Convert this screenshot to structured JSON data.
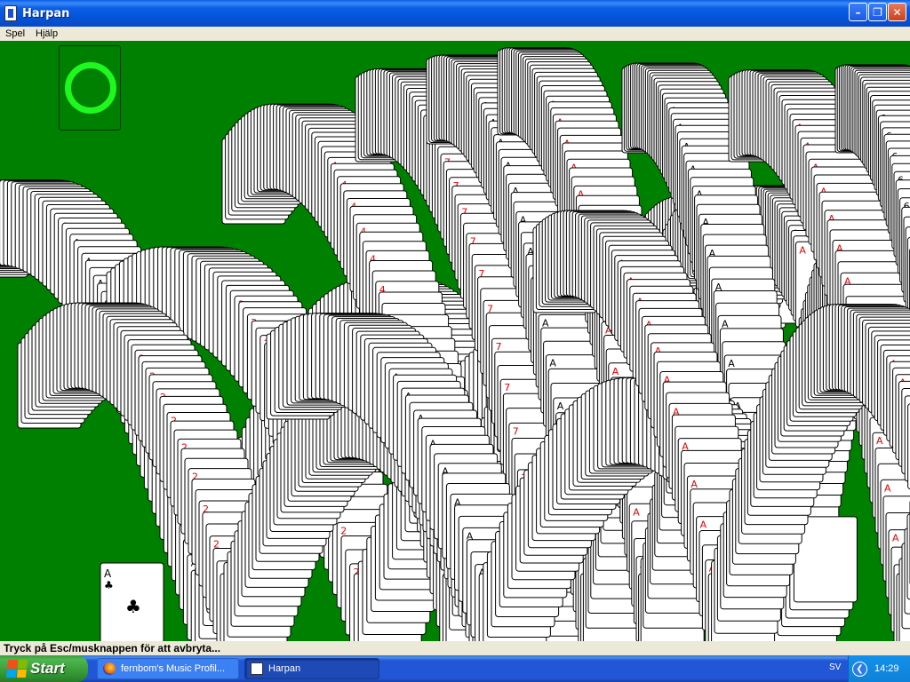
{
  "window": {
    "title": "Harpan",
    "min_symbol": "–",
    "max_symbol": "❐",
    "close_symbol": "✕"
  },
  "menu": {
    "items": [
      "Spel",
      "Hjälp"
    ]
  },
  "status": {
    "text": "Tryck på Esc/musknappen för att avbryta..."
  },
  "taskbar": {
    "start_label": "Start",
    "tasks": [
      {
        "label": "fernbom's Music Profil...",
        "icon": "firefox-icon"
      },
      {
        "label": "Harpan",
        "icon": "harpan-icon"
      }
    ],
    "language": "SV",
    "tray_toggle_symbol": "❮",
    "clock": "14:29"
  },
  "colors": {
    "felt": "#008000",
    "ring": "#1ef81e",
    "titlebar": "#0a5ee8",
    "card_red": "#e00000",
    "card_black": "#000000"
  },
  "game": {
    "bottom_card": {
      "rank": "A",
      "suit": "♣"
    },
    "rank_glyphs": [
      "A",
      "2",
      "4",
      "7",
      "6"
    ]
  }
}
